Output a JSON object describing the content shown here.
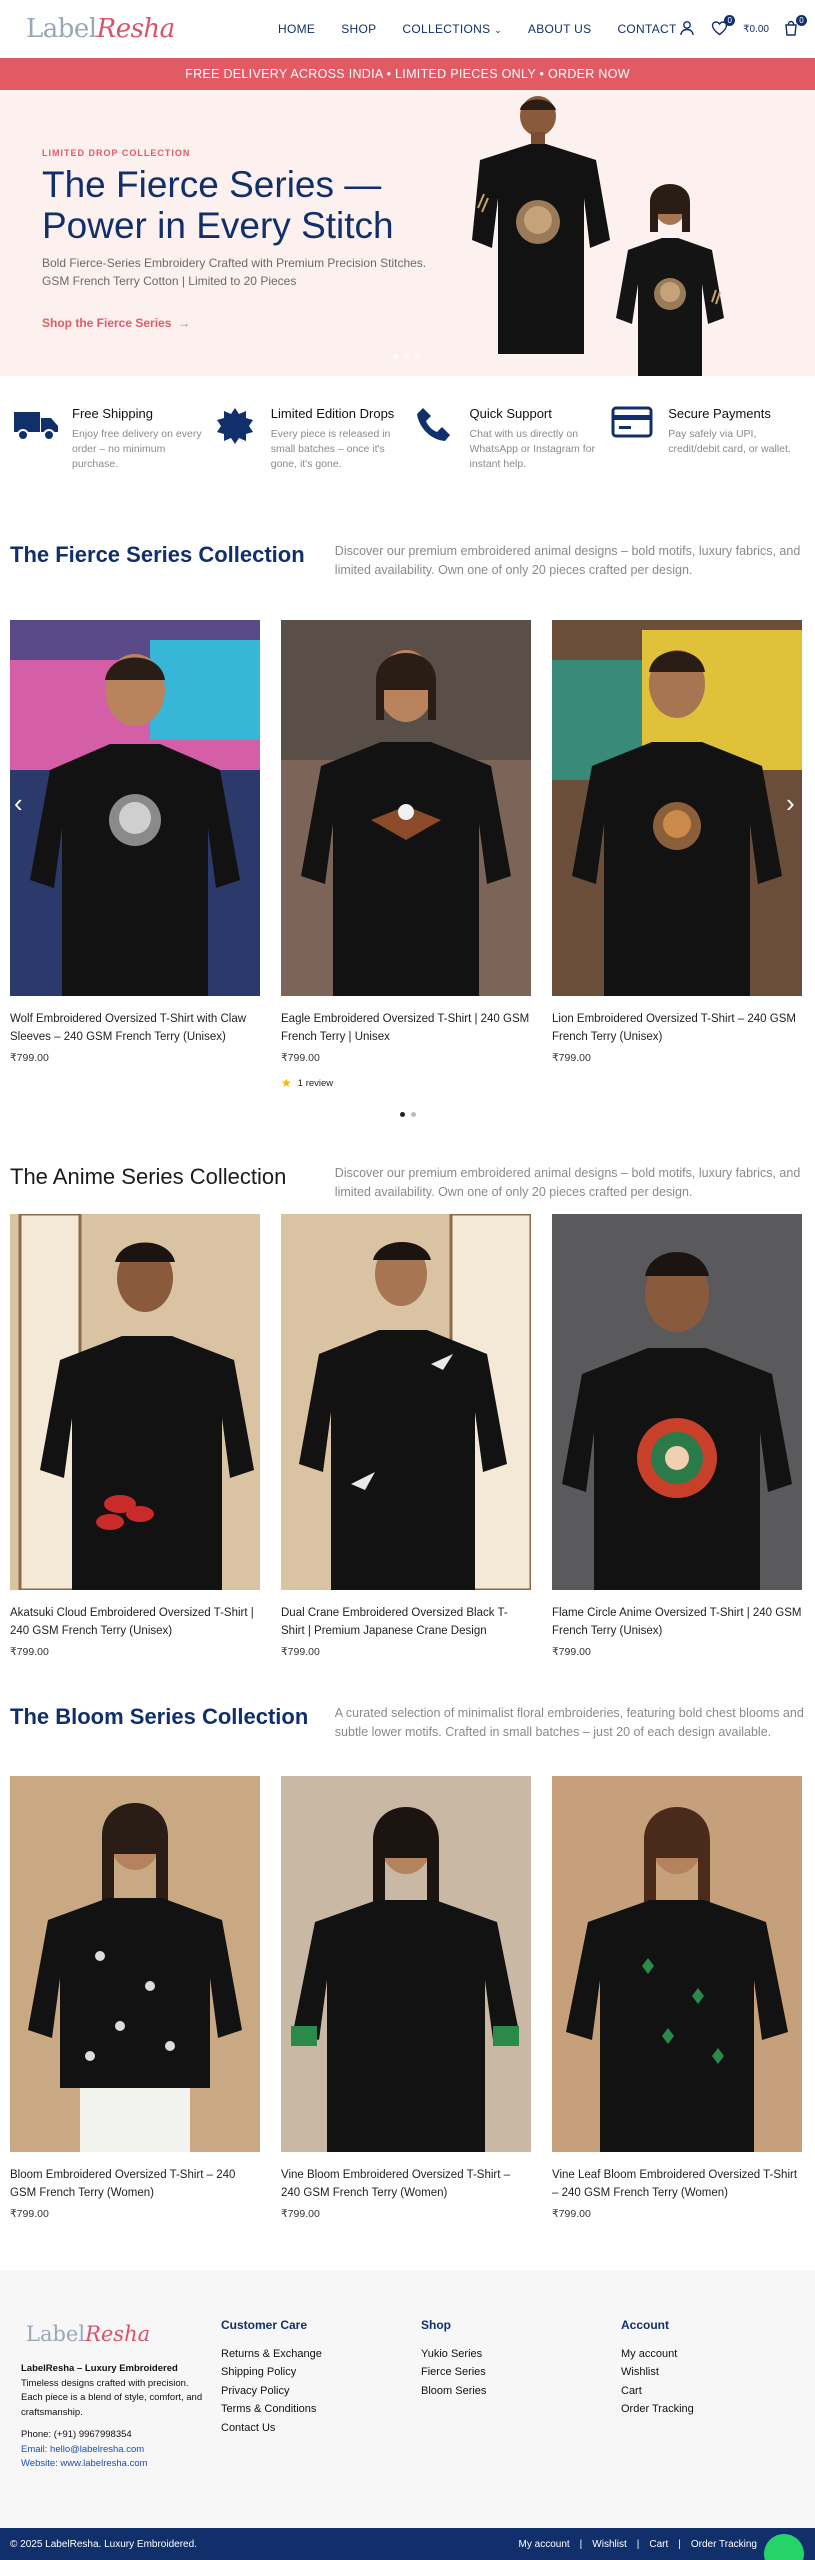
{
  "header": {
    "logo_text_1": "Label",
    "logo_text_2": "Resha",
    "nav": [
      "HOME",
      "SHOP",
      "COLLECTIONS",
      "ABOUT US",
      "CONTACT"
    ],
    "wishlist_count": "0",
    "cart_total": "₹0.00",
    "cart_count": "0"
  },
  "announcement": "FREE DELIVERY ACROSS INDIA • LIMITED PIECES ONLY • ORDER NOW",
  "hero": {
    "eyebrow": "LIMITED DROP COLLECTION",
    "title": "The Fierce Series — Power in Every Stitch",
    "subtitle_1": "Bold Fierce-Series Embroidery Crafted with Premium Precision Stitches.",
    "subtitle_2": "GSM French Terry Cotton | Limited to 20 Pieces",
    "cta": "Shop the Fierce Series",
    "cta_arrow": "→"
  },
  "features": [
    {
      "title": "Free Shipping",
      "desc": "Enjoy free delivery on every order – no minimum purchase.",
      "icon": "truck-icon"
    },
    {
      "title": "Limited Edition Drops",
      "desc": "Every piece is released in small batches – once it's gone, it's gone.",
      "icon": "badge-icon"
    },
    {
      "title": "Quick Support",
      "desc": "Chat with us directly on WhatsApp or Instagram for instant help.",
      "icon": "phone-icon"
    },
    {
      "title": "Secure Payments",
      "desc": "Pay safely via UPI, credit/debit card, or wallet.",
      "icon": "card-icon"
    }
  ],
  "fierce": {
    "title": "The Fierce Series Collection",
    "desc": "Discover our premium embroidered animal designs – bold motifs, luxury fabrics, and limited availability. Own one of only 20 pieces crafted per design.",
    "products": [
      {
        "title": "Wolf Embroidered Oversized T-Shirt with Claw Sleeves – 240 GSM French Terry (Unisex)",
        "price": "₹799.00"
      },
      {
        "title": "Eagle Embroidered Oversized T-Shirt | 240 GSM French Terry | Unisex",
        "price": "₹799.00",
        "rating": "1 review",
        "stars": 1
      },
      {
        "title": "Lion Embroidered Oversized T-Shirt – 240 GSM French Terry (Unisex)",
        "price": "₹799.00"
      }
    ]
  },
  "anime": {
    "title": "The Anime Series Collection",
    "desc": "Discover our premium embroidered animal designs – bold motifs, luxury fabrics, and limited availability. Own one of only 20 pieces crafted per design.",
    "products": [
      {
        "title": "Akatsuki Cloud Embroidered Oversized T-Shirt | 240 GSM French Terry (Unisex)",
        "price": "₹799.00"
      },
      {
        "title": "Dual Crane Embroidered Oversized Black T-Shirt | Premium Japanese Crane Design",
        "price": "₹799.00"
      },
      {
        "title": "Flame Circle Anime Oversized T-Shirt | 240 GSM French Terry (Unisex)",
        "price": "₹799.00"
      }
    ]
  },
  "bloom": {
    "title": "The Bloom Series Collection",
    "desc": "A curated selection of minimalist floral embroideries, featuring bold chest blooms and subtle lower motifs. Crafted in small batches – just 20 of each design available.",
    "products": [
      {
        "title": "Bloom Embroidered Oversized T-Shirt – 240 GSM French Terry (Women)",
        "price": "₹799.00"
      },
      {
        "title": "Vine Bloom Embroidered Oversized T-Shirt – 240 GSM French Terry (Women)",
        "price": "₹799.00"
      },
      {
        "title": "Vine Leaf Bloom Embroidered Oversized T-Shirt – 240 GSM French Terry (Women)",
        "price": "₹799.00"
      }
    ]
  },
  "footer": {
    "brand": "LabelResha – Luxury Embroidered",
    "about": "Timeless designs crafted with precision. Each piece is a blend of style, comfort, and craftsmanship.",
    "phone": "Phone: (+91) 9967998354",
    "email": "Email: hello@labelresha.com",
    "website": "Website: www.labelresha.com",
    "care_title": "Customer Care",
    "care": [
      "Returns & Exchange",
      "Shipping Policy",
      "Privacy Policy",
      "Terms & Conditions",
      "Contact Us"
    ],
    "shop_title": "Shop",
    "shop": [
      "Yukio Series",
      "Fierce Series",
      "Bloom Series"
    ],
    "account_title": "Account",
    "account": [
      "My account",
      "Wishlist",
      "Cart",
      "Order Tracking"
    ],
    "copyright": "© 2025 LabelResha. Luxury Embroidered.",
    "bottom_links": [
      "My account",
      "Wishlist",
      "Cart",
      "Order Tracking"
    ]
  },
  "colors": {
    "navy": "#11306b",
    "coral": "#e25b64",
    "hero_bg": "#fcf1ef"
  }
}
